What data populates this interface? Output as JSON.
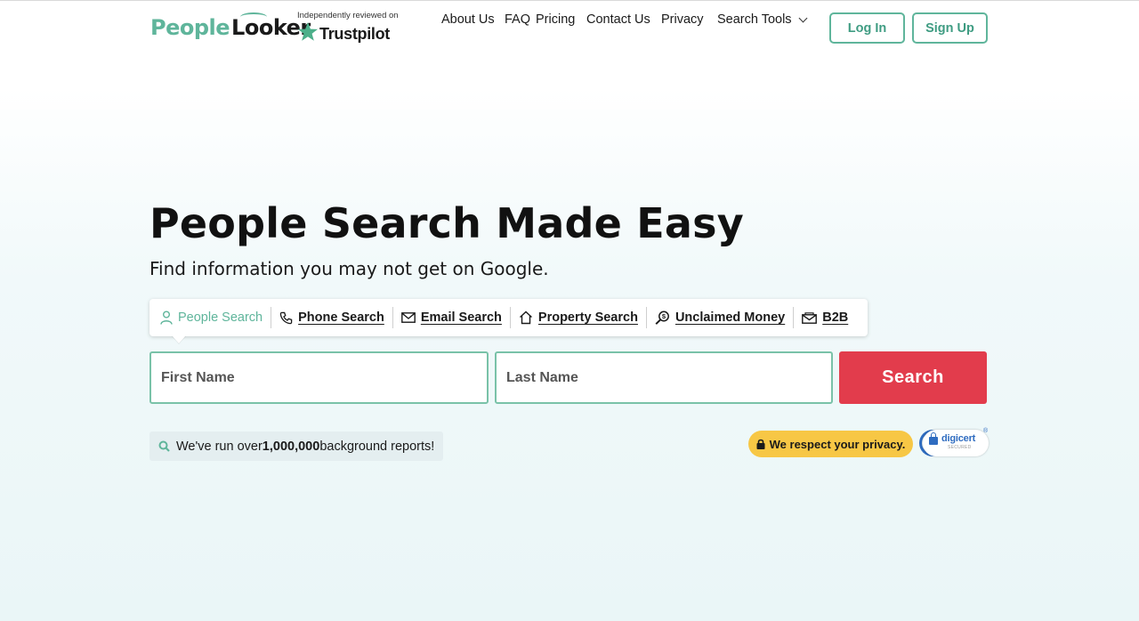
{
  "brand": {
    "name_part1": "People",
    "name_part2": "Looker",
    "review_caption": "Independently reviewed on",
    "review_site": "Trustpilot",
    "accent_color": "#5fb59b",
    "trustpilot_color": "#00b67a"
  },
  "nav": {
    "items": [
      "About Us",
      "FAQ",
      "Pricing",
      "Contact Us",
      "Privacy"
    ],
    "search_tools": "Search Tools",
    "login": "Log In",
    "signup": "Sign Up"
  },
  "hero": {
    "title": "People Search Made Easy",
    "subtitle": "Find information you may not get on Google."
  },
  "search_tabs": [
    {
      "label": "People Search",
      "icon": "person-icon",
      "active": true
    },
    {
      "label": "Phone Search",
      "icon": "phone-icon",
      "active": false
    },
    {
      "label": "Email Search",
      "icon": "envelope-icon",
      "active": false
    },
    {
      "label": "Property Search",
      "icon": "house-icon",
      "active": false
    },
    {
      "label": "Unclaimed Money",
      "icon": "magnifier-dollar-icon",
      "active": false
    },
    {
      "label": "B2B",
      "icon": "business-envelope-icon",
      "active": false
    }
  ],
  "form": {
    "first_placeholder": "First Name",
    "last_placeholder": "Last Name",
    "search_button": "Search",
    "search_button_color": "#e23c4c"
  },
  "stats": {
    "prefix": "We've run over ",
    "count": "1,000,000",
    "suffix": " background reports!"
  },
  "trust": {
    "privacy_label": "We respect your privacy.",
    "privacy_color": "#f7c745",
    "digicert_name": "digicert",
    "digicert_sub": "SECURED",
    "digicert_mark": "®"
  }
}
